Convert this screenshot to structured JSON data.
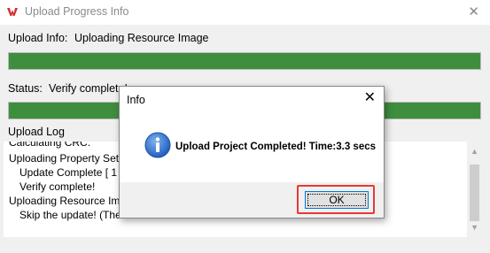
{
  "window": {
    "title": "Upload Progress Info",
    "logo_icon": "brand-logo-icon",
    "close_glyph": "✕"
  },
  "upload": {
    "info_label": "Upload Info:",
    "info_value": "Uploading Resource Image",
    "progress_percent": 100,
    "status_label": "Status:",
    "status_value": "Verify complete!",
    "status_progress_percent": 100,
    "bar_color": "#3e8e3e"
  },
  "log": {
    "title": "Upload Log",
    "lines": [
      "Calculating CRC.",
      "Uploading Property Settings",
      "Update Complete [ 1",
      "Verify complete!",
      "Uploading Resource Image",
      "Skip the update! (The"
    ],
    "scroll_up_glyph": "▲",
    "scroll_down_glyph": "▼"
  },
  "dialog": {
    "title": "Info",
    "close_glyph": "✕",
    "icon": "info-icon",
    "message": "Upload Project Completed! Time:3.3 secs",
    "ok_label": "OK",
    "highlight_color": "#e53935"
  }
}
